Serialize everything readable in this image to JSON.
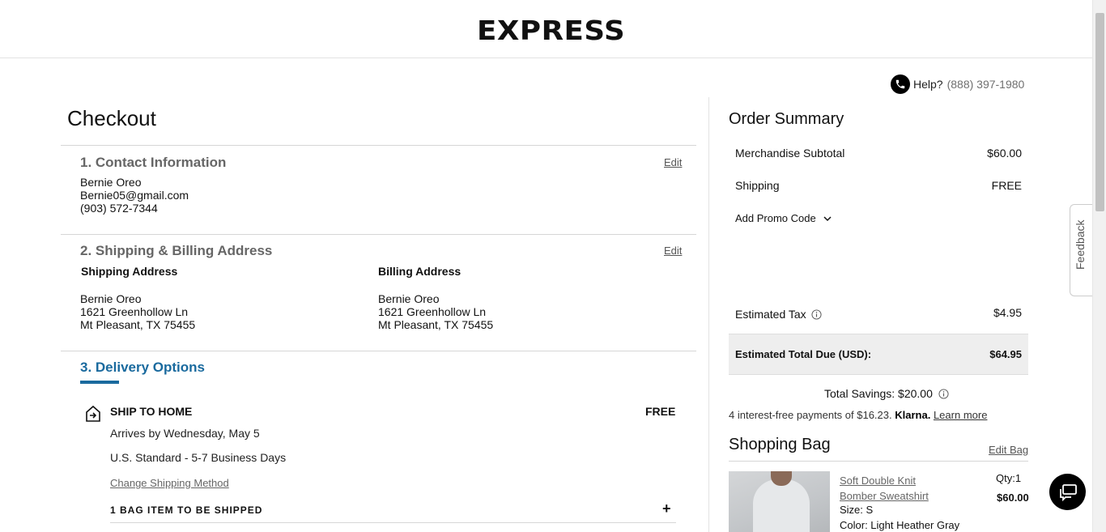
{
  "header": {
    "logo": "EXPRESS"
  },
  "help": {
    "label": "Help?",
    "phone": "(888) 397-1980"
  },
  "checkout": {
    "title": "Checkout",
    "contact": {
      "title": "1. Contact Information",
      "edit": "Edit",
      "name": "Bernie Oreo",
      "email": "Bernie05@gmail.com",
      "phone": "(903) 572-7344"
    },
    "address": {
      "title": "2. Shipping & Billing Address",
      "edit": "Edit",
      "shipping_label": "Shipping Address",
      "billing_label": "Billing Address",
      "shipping": {
        "name": "Bernie Oreo",
        "line1": "1621 Greenhollow Ln",
        "line2": "Mt Pleasant, TX 75455"
      },
      "billing": {
        "name": "Bernie Oreo",
        "line1": "1621 Greenhollow Ln",
        "line2": "Mt Pleasant, TX 75455"
      }
    },
    "delivery": {
      "title": "3. Delivery Options",
      "method": "SHIP TO HOME",
      "price": "FREE",
      "arrives": "Arrives by Wednesday, May 5",
      "service": "U.S. Standard - 5-7 Business Days",
      "change_link": "Change Shipping Method",
      "items_label": "1 BAG ITEM TO BE SHIPPED",
      "expand": "+"
    }
  },
  "summary": {
    "title": "Order Summary",
    "subtotal_label": "Merchandise Subtotal",
    "subtotal_value": "$60.00",
    "shipping_label": "Shipping",
    "shipping_value": "FREE",
    "promo_label": "Add Promo Code",
    "tax_label": "Estimated Tax",
    "tax_value": "$4.95",
    "total_label": "Estimated Total Due (USD):",
    "total_value": "$64.95",
    "savings": "Total Savings: $20.00",
    "klarna_text": "4 interest-free payments of $16.23.",
    "klarna_brand": "Klarna.",
    "klarna_link": "Learn more"
  },
  "bag": {
    "title": "Shopping Bag",
    "edit": "Edit Bag",
    "item": {
      "name_line1": "Soft Double Knit",
      "name_line2": "Bomber Sweatshirt",
      "qty": "Qty:1",
      "price": "$60.00",
      "size": "Size: S",
      "color": "Color: Light Heather Gray"
    }
  },
  "feedback": {
    "label": "Feedback"
  },
  "icons": [
    "phone-icon",
    "info-icon",
    "chevron-down-icon",
    "ship-home-icon",
    "chat-icon"
  ]
}
